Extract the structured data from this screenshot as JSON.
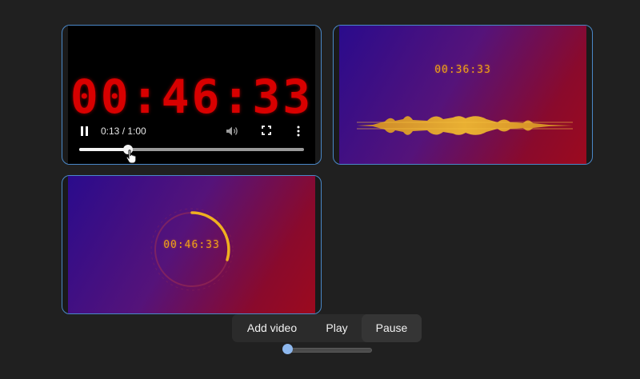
{
  "videos": [
    {
      "overlay_time": "00:46:33",
      "controls": {
        "time_display": "0:13 / 1:00",
        "progress": 0.2167,
        "play_state_icon": "pause-icon",
        "volume_icon": "volume-icon",
        "fullscreen_icon": "fullscreen-icon",
        "more_icon": "more-options-icon"
      },
      "style": "red-digital-clock"
    },
    {
      "overlay_time": "00:36:33",
      "style": "waveform"
    },
    {
      "overlay_time": "00:46:33",
      "style": "circular-ring"
    }
  ],
  "toolbar": {
    "add_label": "Add video",
    "play_label": "Play",
    "pause_label": "Pause"
  },
  "slider": {
    "value": 0.04
  },
  "colors": {
    "background": "#202020",
    "tile_border": "#4a88c8",
    "clock_red": "#d80000",
    "clock_amber": "#f0a018",
    "gradient_start": "#2a0b8c",
    "gradient_end": "#9c0a1e",
    "slider_thumb": "#8eb8ee"
  }
}
